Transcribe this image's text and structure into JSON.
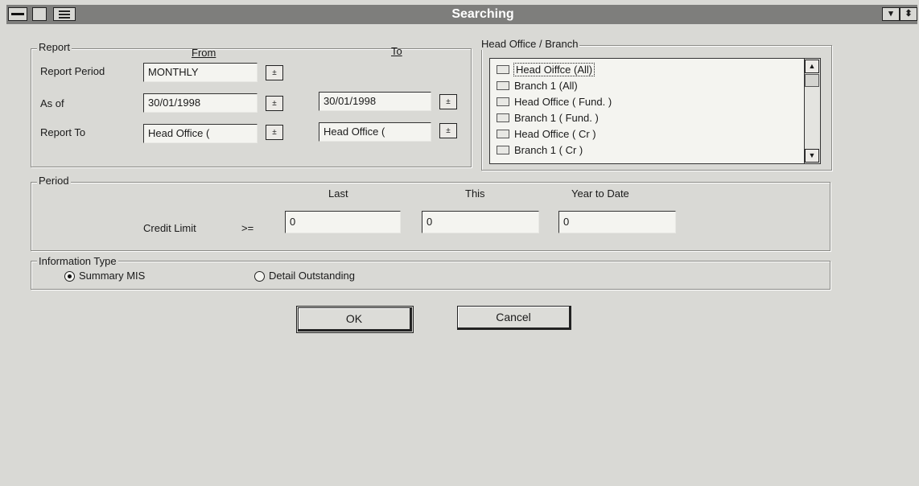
{
  "window": {
    "title": "Searching",
    "title_bar_color": "#7e7e7c",
    "minimize_glyph": "▾",
    "restore_glyph": "⬍"
  },
  "report": {
    "legend": "Report",
    "from_header": "From",
    "to_header": "To",
    "rows": [
      {
        "label": "Report Period",
        "from_value": "MONTHLY",
        "to_value": null
      },
      {
        "label": "As of",
        "from_value": "30/01/1998",
        "to_value": "30/01/1998"
      },
      {
        "label": "Report To",
        "from_value": "Head Office (",
        "to_value": "Head Office ("
      }
    ],
    "spin_glyph": "±"
  },
  "branch": {
    "legend": "Head Office / Branch",
    "items": [
      "Head Oiffce (All)",
      "Branch 1 (All)",
      "Head Office ( Fund. )",
      "Branch 1 ( Fund. )",
      "Head Office ( Cr )",
      "Branch 1 ( Cr )"
    ],
    "selected_index": 0,
    "scroll_up_glyph": "▲",
    "scroll_down_glyph": "▼"
  },
  "period": {
    "legend": "Period",
    "col_last": "Last",
    "col_this": "This",
    "col_ytd": "Year to Date",
    "credit_label": "Credit Limit",
    "operator": ">=",
    "last_value": "0",
    "this_value": "0",
    "ytd_value": "0"
  },
  "info_type": {
    "legend": "Information Type",
    "options": [
      "Summary MIS",
      "Detail Outstanding"
    ],
    "selected": "Summary MIS"
  },
  "buttons": {
    "ok": "OK",
    "cancel": "Cancel"
  }
}
